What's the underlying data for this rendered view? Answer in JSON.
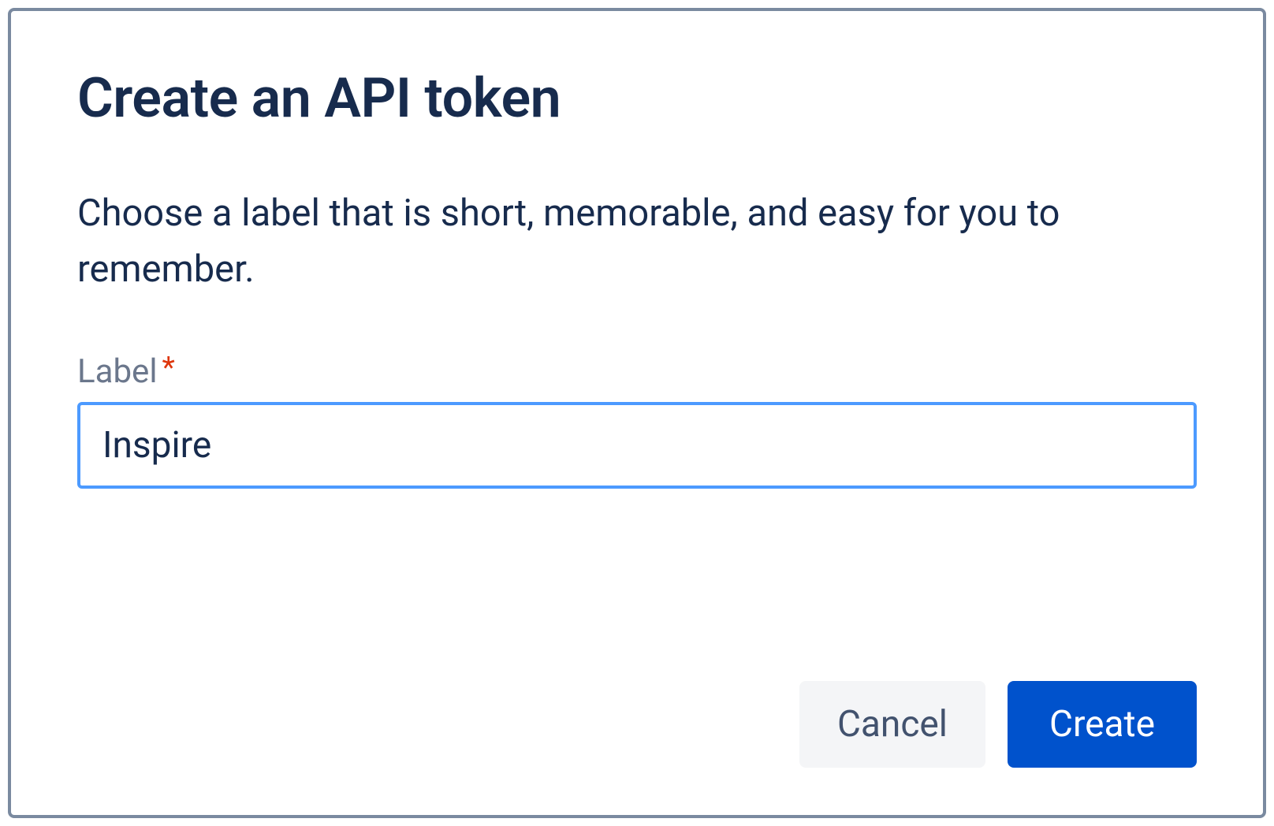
{
  "dialog": {
    "title": "Create an API token",
    "description": "Choose a label that is short, memorable, and easy for you to remember.",
    "field": {
      "label": "Label",
      "required_marker": "*",
      "value": "Inspire"
    },
    "buttons": {
      "cancel": "Cancel",
      "create": "Create"
    }
  },
  "colors": {
    "primary": "#0052CC",
    "focus_border": "#4C9AFF",
    "text_heading": "#172B4D",
    "text_subtle": "#6B778C",
    "danger": "#DE350B",
    "dialog_border": "#7a8aa0",
    "btn_cancel_bg": "#f4f5f7"
  }
}
